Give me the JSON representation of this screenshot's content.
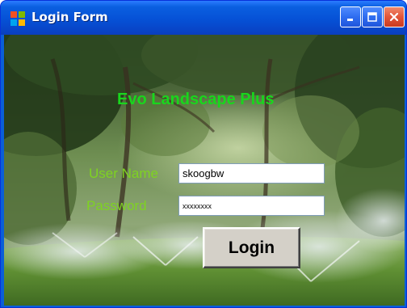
{
  "window": {
    "title": "Login Form",
    "icon": "windows-app-icon",
    "controls": [
      "minimize-icon",
      "maximize-icon",
      "close-icon"
    ]
  },
  "form": {
    "heading": "Evo Landscape Plus",
    "username_label": "User Name",
    "username_value": "skoogbw",
    "password_label": "Password",
    "password_value": "xxxxxxxx",
    "login_label": "Login"
  },
  "colors": {
    "heading": "#19d61d",
    "labels": "#7ed321",
    "titlebar": "#0a5fd8",
    "button_face": "#d4d0c8"
  }
}
